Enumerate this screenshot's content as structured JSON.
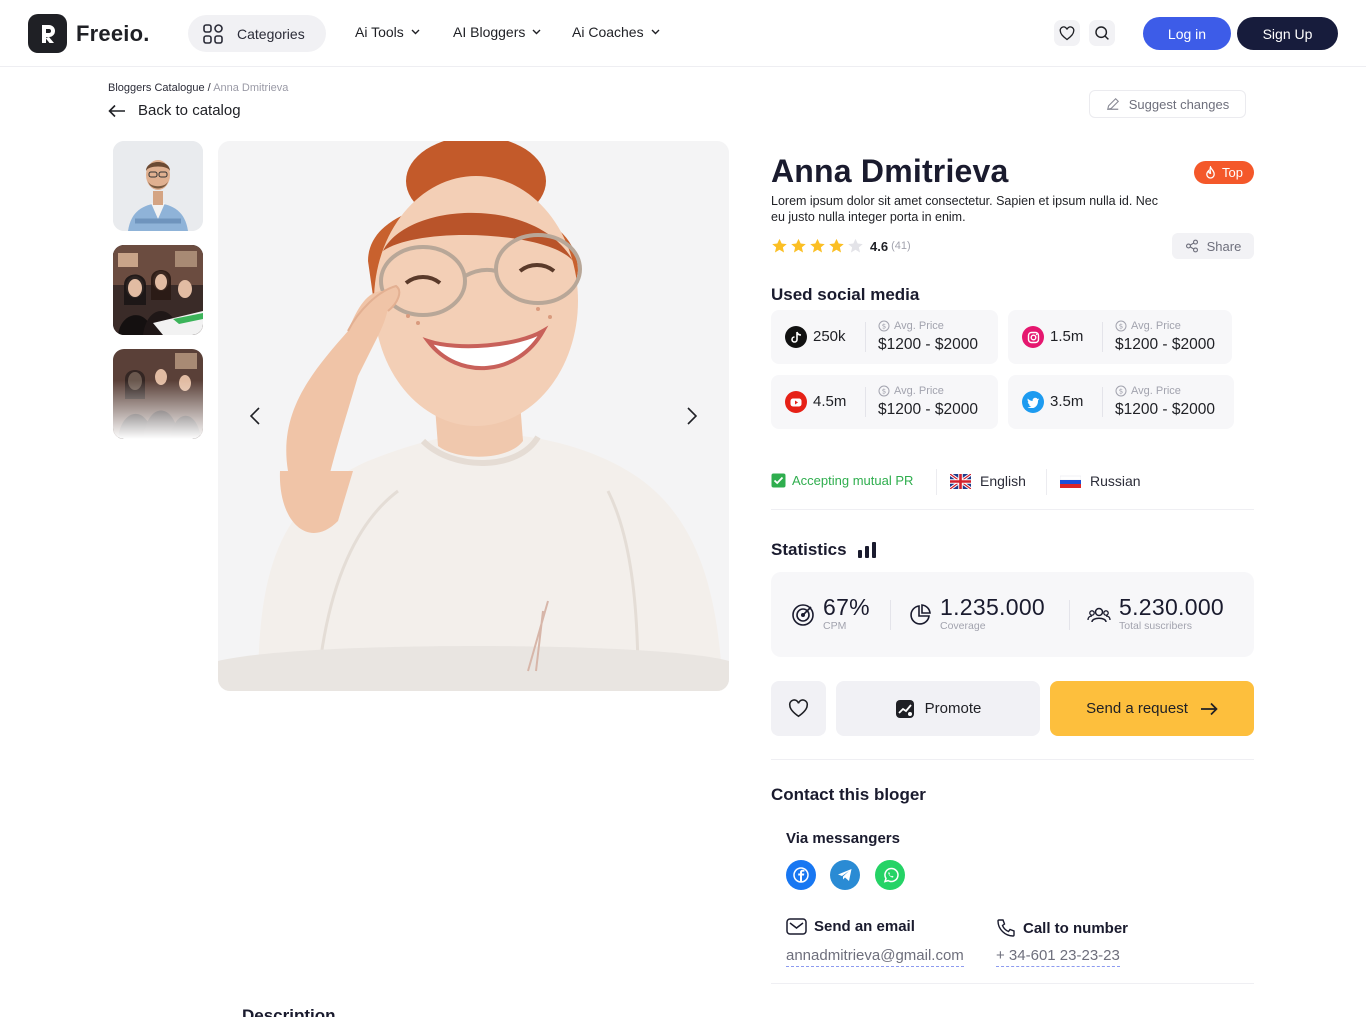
{
  "header": {
    "logo_text": "Freeio.",
    "categories_label": "Categories",
    "nav": [
      {
        "label": "Ai Tools"
      },
      {
        "label": "AI Bloggers"
      },
      {
        "label": "Ai Coaches"
      }
    ],
    "login_label": "Log in",
    "signup_label": "Sign Up"
  },
  "breadcrumb": {
    "parent": "Bloggers Catalogue",
    "separator": " / ",
    "current": "Anna Dmitrieva"
  },
  "back_label": "Back to catalog",
  "suggest_label": "Suggest changes",
  "profile": {
    "name": "Anna Dmitrieva",
    "badge": "Top",
    "bio": "Lorem ipsum dolor sit amet consectetur. Sapien et ipsum nulla id. Nec eu justo nulla integer porta in enim.",
    "rating": "4.6",
    "rating_count": "(41)",
    "stars_filled": 4,
    "stars_total": 5,
    "share_label": "Share"
  },
  "social": {
    "title": "Used social media",
    "avg_label": "Avg. Price",
    "items": [
      {
        "platform": "tiktok-icon",
        "count": "250k",
        "price": "$1200 - $2000",
        "color": "#111111"
      },
      {
        "platform": "instagram-icon",
        "count": "1.5m",
        "price": "$1200 - $2000",
        "color": "#e5176f"
      },
      {
        "platform": "youtube-icon",
        "count": "4.5m",
        "price": "$1200 - $2000",
        "color": "#e62117"
      },
      {
        "platform": "twitter-icon",
        "count": "3.5m",
        "price": "$1200 - $2000",
        "color": "#1d9bf0"
      }
    ]
  },
  "tags": {
    "mutual_pr": "Accepting mutual PR",
    "languages": [
      "English",
      "Russian"
    ],
    "accent_green": "#2fae4e"
  },
  "statistics": {
    "title": "Statistics",
    "items": [
      {
        "value": "67%",
        "label": "CPM"
      },
      {
        "value": "1.235.000",
        "label": "Coverage"
      },
      {
        "value": "5.230.000",
        "label": "Total suscribers"
      }
    ]
  },
  "actions": {
    "promote_label": "Promote",
    "request_label": "Send a request"
  },
  "contact": {
    "title": "Contact this bloger",
    "messengers_label": "Via messangers",
    "messengers": [
      {
        "icon": "facebook-icon",
        "color": "#1877f2"
      },
      {
        "icon": "telegram-icon",
        "color": "#2a8bd4"
      },
      {
        "icon": "whatsapp-icon",
        "color": "#25d366"
      }
    ],
    "email_label": "Send an email",
    "email": "annadmitrieva@gmail.com",
    "phone_label": "Call to number",
    "phone": "+ 34-601 23-23-23"
  },
  "description_title": "Description"
}
